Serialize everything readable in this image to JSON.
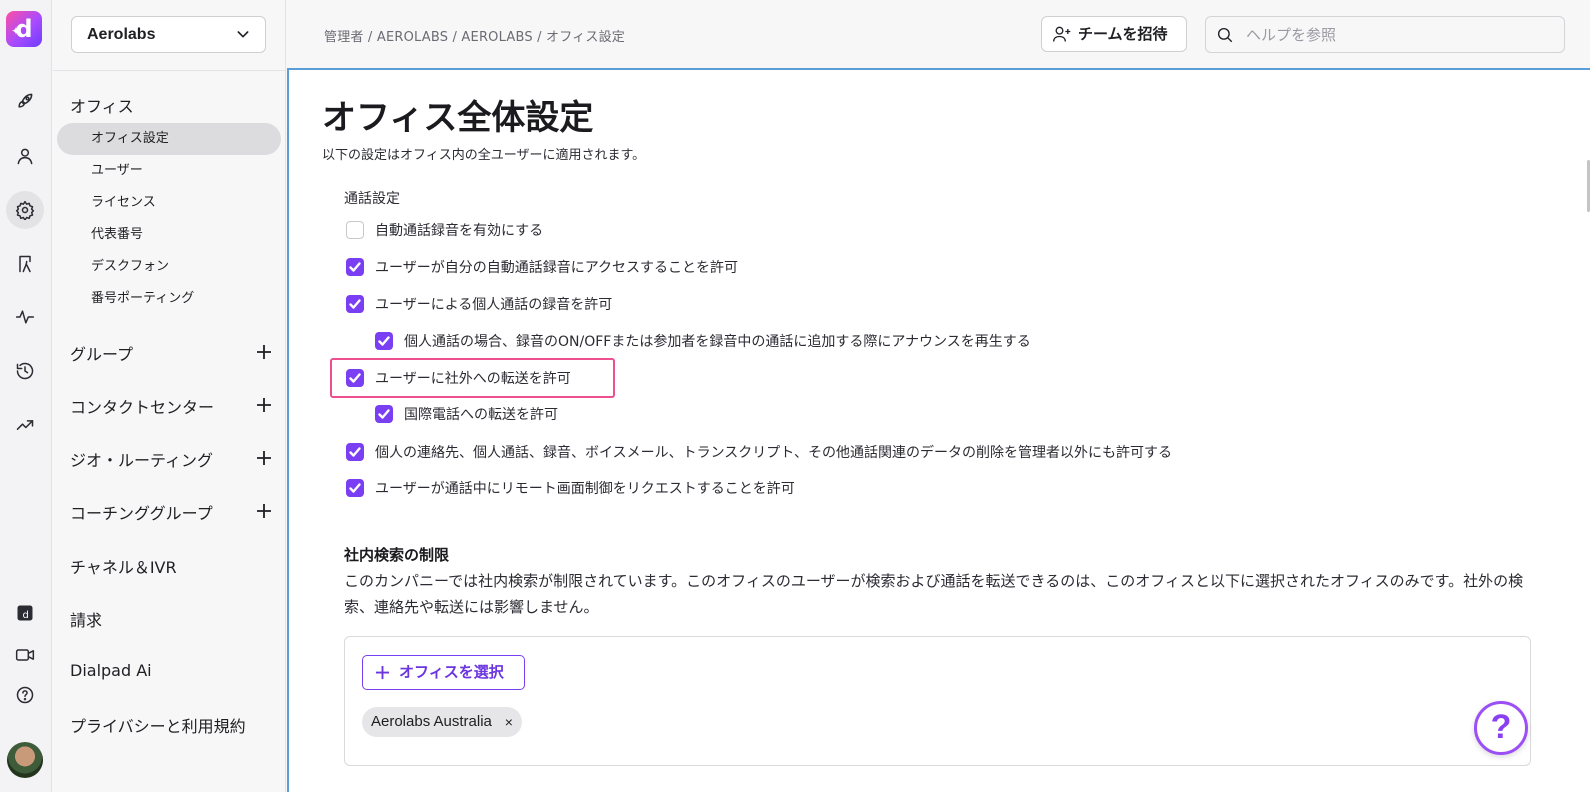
{
  "app": {
    "logo_letter": "d"
  },
  "rail": {
    "icons": [
      "rocket-icon",
      "user-icon",
      "gear-icon",
      "tree-icon",
      "pulse-icon",
      "history-icon",
      "trend-icon",
      "dialpad-app-icon",
      "video-icon",
      "help-icon"
    ],
    "active": "gear-icon"
  },
  "nav": {
    "office_select": "Aerolabs",
    "office_heading": "オフィス",
    "office_items": [
      "オフィス設定",
      "ユーザー",
      "ライセンス",
      "代表番号",
      "デスクフォン",
      "番号ポーティング"
    ],
    "group_heading": "グループ",
    "contact_center_heading": "コンタクトセンター",
    "geo_routing_heading": "ジオ・ルーティング",
    "coaching_heading": "コーチンググループ",
    "channel_heading": "チャネル＆IVR",
    "billing_heading": "請求",
    "ai_heading": "Dialpad Ai",
    "privacy_heading": "プライバシーと利用規約"
  },
  "topbar": {
    "breadcrumb": "管理者 / AEROLABS / AEROLABS / オフィス設定",
    "invite_label": "チームを招待",
    "search_placeholder": "ヘルプを参照"
  },
  "main": {
    "title": "オフィス全体設定",
    "subtitle": "以下の設定はオフィス内の全ユーザーに適用されます。",
    "call_settings_label": "通話設定",
    "options": [
      {
        "label": "自動通話録音を有効にする",
        "checked": false
      },
      {
        "label": "ユーザーが自分の自動通話録音にアクセスすることを許可",
        "checked": true
      },
      {
        "label": "ユーザーによる個人通話の録音を許可",
        "checked": true
      },
      {
        "label": "個人通話の場合、録音のON/OFFまたは参加者を録音中の通話に追加する際にアナウンスを再生する",
        "checked": true
      },
      {
        "label": "ユーザーに社外への転送を許可",
        "checked": true
      },
      {
        "label": "国際電話への転送を許可",
        "checked": true
      },
      {
        "label": "個人の連絡先、個人通話、録音、ボイスメール、トランスクリプト、その他通話関連のデータの削除を管理者以外にも許可する",
        "checked": true
      },
      {
        "label": "ユーザーが通話中にリモート画面制御をリクエストすることを許可",
        "checked": true
      }
    ],
    "restrict_title": "社内検索の制限",
    "restrict_desc": "このカンパニーでは社内検索が制限されています。このオフィスのユーザーが検索および通話を転送できるのは、このオフィスと以下に選択されたオフィスのみです。社外の検索、連絡先や転送には影響しません。",
    "select_office_label": "オフィスを選択",
    "chip_label": "Aerolabs Australia",
    "chip_remove": "×",
    "help_glyph": "?"
  },
  "colors": {
    "accent": "#7a3ff2",
    "highlight": "#ee4f8f",
    "content_border": "#5b9dd9"
  }
}
